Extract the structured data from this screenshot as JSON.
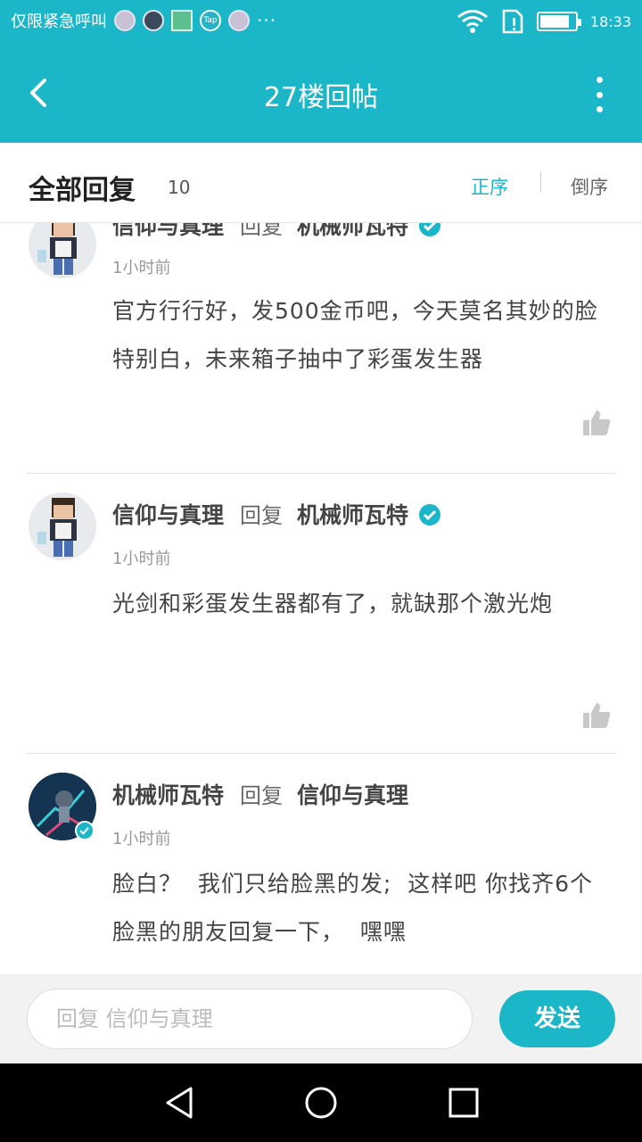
{
  "status_bar": {
    "carrier_text": "仅限紧急呼叫",
    "more": "···",
    "tap_icon_text": "Tap",
    "time": "18:33",
    "battery_level": 0.85
  },
  "app_bar": {
    "title": "27楼回帖"
  },
  "header": {
    "all_replies_label": "全部回复",
    "count": "10",
    "sort_asc": "正序",
    "sort_desc": "倒序"
  },
  "replies": [
    {
      "author": "信仰与真理",
      "reply_word": "回复",
      "target": "机械师瓦特",
      "target_verified": true,
      "time": "1小时前",
      "content": "官方行行好，发500金币吧，今天莫名其妙的脸特别白，未来箱子抽中了彩蛋发生器"
    },
    {
      "author": "信仰与真理",
      "reply_word": "回复",
      "target": "机械师瓦特",
      "target_verified": true,
      "time": "1小时前",
      "content": "光剑和彩蛋发生器都有了，就缺那个激光炮"
    },
    {
      "author": "机械师瓦特",
      "reply_word": "回复",
      "target": "信仰与真理",
      "author_verified": true,
      "time": "1小时前",
      "content": "脸白？  我们只给脸黑的发;  这样吧 你找齐6个脸黑的朋友回复一下，  嘿嘿"
    }
  ],
  "reply_bar": {
    "placeholder": "回复  信仰与真理",
    "send_label": "发送"
  },
  "colors": {
    "accent": "#1bb7c9",
    "background": "#ffffff",
    "divider": "#e2e2e2",
    "nav": "#000000"
  }
}
